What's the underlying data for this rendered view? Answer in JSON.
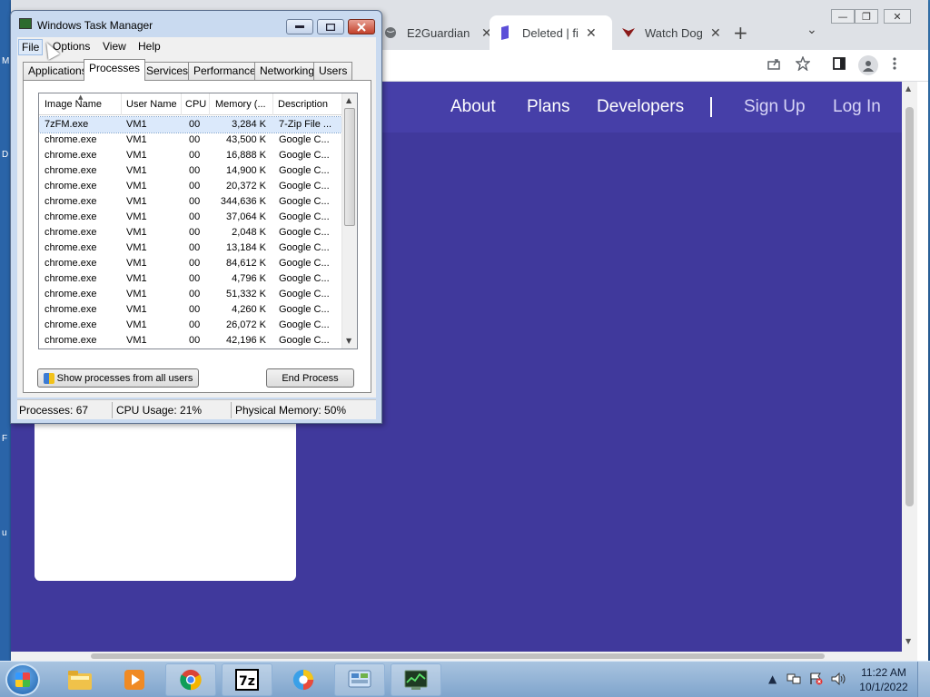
{
  "desktop": {
    "edge_letters": [
      "M",
      "D",
      "F",
      "u"
    ]
  },
  "chrome": {
    "tabs": [
      {
        "title": "E2Guardian",
        "close": "✕",
        "active": false
      },
      {
        "title": "Deleted | file",
        "close": "✕",
        "active": true
      },
      {
        "title": "Watch Dogs",
        "close": "✕",
        "active": false
      }
    ],
    "new_tab": "+",
    "tab_menu": "⌄",
    "window_buttons": {
      "minimize": "—",
      "maximize": "❐",
      "close": "✕"
    }
  },
  "website": {
    "nav": [
      {
        "label": "About"
      },
      {
        "label": "Plans"
      },
      {
        "label": "Developers"
      },
      {
        "label": "Sign Up"
      },
      {
        "label": "Log In"
      }
    ],
    "background": "#40399c"
  },
  "task_manager": {
    "title": "Windows Task Manager",
    "menu": [
      "File",
      "Options",
      "View",
      "Help"
    ],
    "tabs": [
      "Applications",
      "Processes",
      "Services",
      "Performance",
      "Networking",
      "Users"
    ],
    "active_tab": "Processes",
    "columns": [
      "Image Name",
      "User Name",
      "CPU",
      "Memory (...",
      "Description"
    ],
    "rows": [
      {
        "image": "7zFM.exe",
        "user": "VM1",
        "cpu": "00",
        "memory": "3,284 K",
        "description": "7-Zip File ..."
      },
      {
        "image": "chrome.exe",
        "user": "VM1",
        "cpu": "00",
        "memory": "43,500 K",
        "description": "Google C..."
      },
      {
        "image": "chrome.exe",
        "user": "VM1",
        "cpu": "00",
        "memory": "16,888 K",
        "description": "Google C..."
      },
      {
        "image": "chrome.exe",
        "user": "VM1",
        "cpu": "00",
        "memory": "14,900 K",
        "description": "Google C..."
      },
      {
        "image": "chrome.exe",
        "user": "VM1",
        "cpu": "00",
        "memory": "20,372 K",
        "description": "Google C..."
      },
      {
        "image": "chrome.exe",
        "user": "VM1",
        "cpu": "00",
        "memory": "344,636 K",
        "description": "Google C..."
      },
      {
        "image": "chrome.exe",
        "user": "VM1",
        "cpu": "00",
        "memory": "37,064 K",
        "description": "Google C..."
      },
      {
        "image": "chrome.exe",
        "user": "VM1",
        "cpu": "00",
        "memory": "2,048 K",
        "description": "Google C..."
      },
      {
        "image": "chrome.exe",
        "user": "VM1",
        "cpu": "00",
        "memory": "13,184 K",
        "description": "Google C..."
      },
      {
        "image": "chrome.exe",
        "user": "VM1",
        "cpu": "00",
        "memory": "84,612 K",
        "description": "Google C..."
      },
      {
        "image": "chrome.exe",
        "user": "VM1",
        "cpu": "00",
        "memory": "4,796 K",
        "description": "Google C..."
      },
      {
        "image": "chrome.exe",
        "user": "VM1",
        "cpu": "00",
        "memory": "51,332 K",
        "description": "Google C..."
      },
      {
        "image": "chrome.exe",
        "user": "VM1",
        "cpu": "00",
        "memory": "4,260 K",
        "description": "Google C..."
      },
      {
        "image": "chrome.exe",
        "user": "VM1",
        "cpu": "00",
        "memory": "26,072 K",
        "description": "Google C..."
      },
      {
        "image": "chrome.exe",
        "user": "VM1",
        "cpu": "00",
        "memory": "42,196 K",
        "description": "Google C..."
      }
    ],
    "selected_row": 0,
    "show_all_button": "Show processes from all users",
    "end_process_button": "End Process",
    "status": {
      "processes": "Processes: 67",
      "cpu": "CPU Usage: 21%",
      "memory": "Physical Memory: 50%"
    }
  },
  "taskbar": {
    "apps": [
      "windows-explorer",
      "media-player",
      "chrome",
      "7-zip",
      "browser",
      "control-panel",
      "task-manager"
    ],
    "clock": {
      "time": "11:22 AM",
      "date": "10/1/2022"
    }
  }
}
